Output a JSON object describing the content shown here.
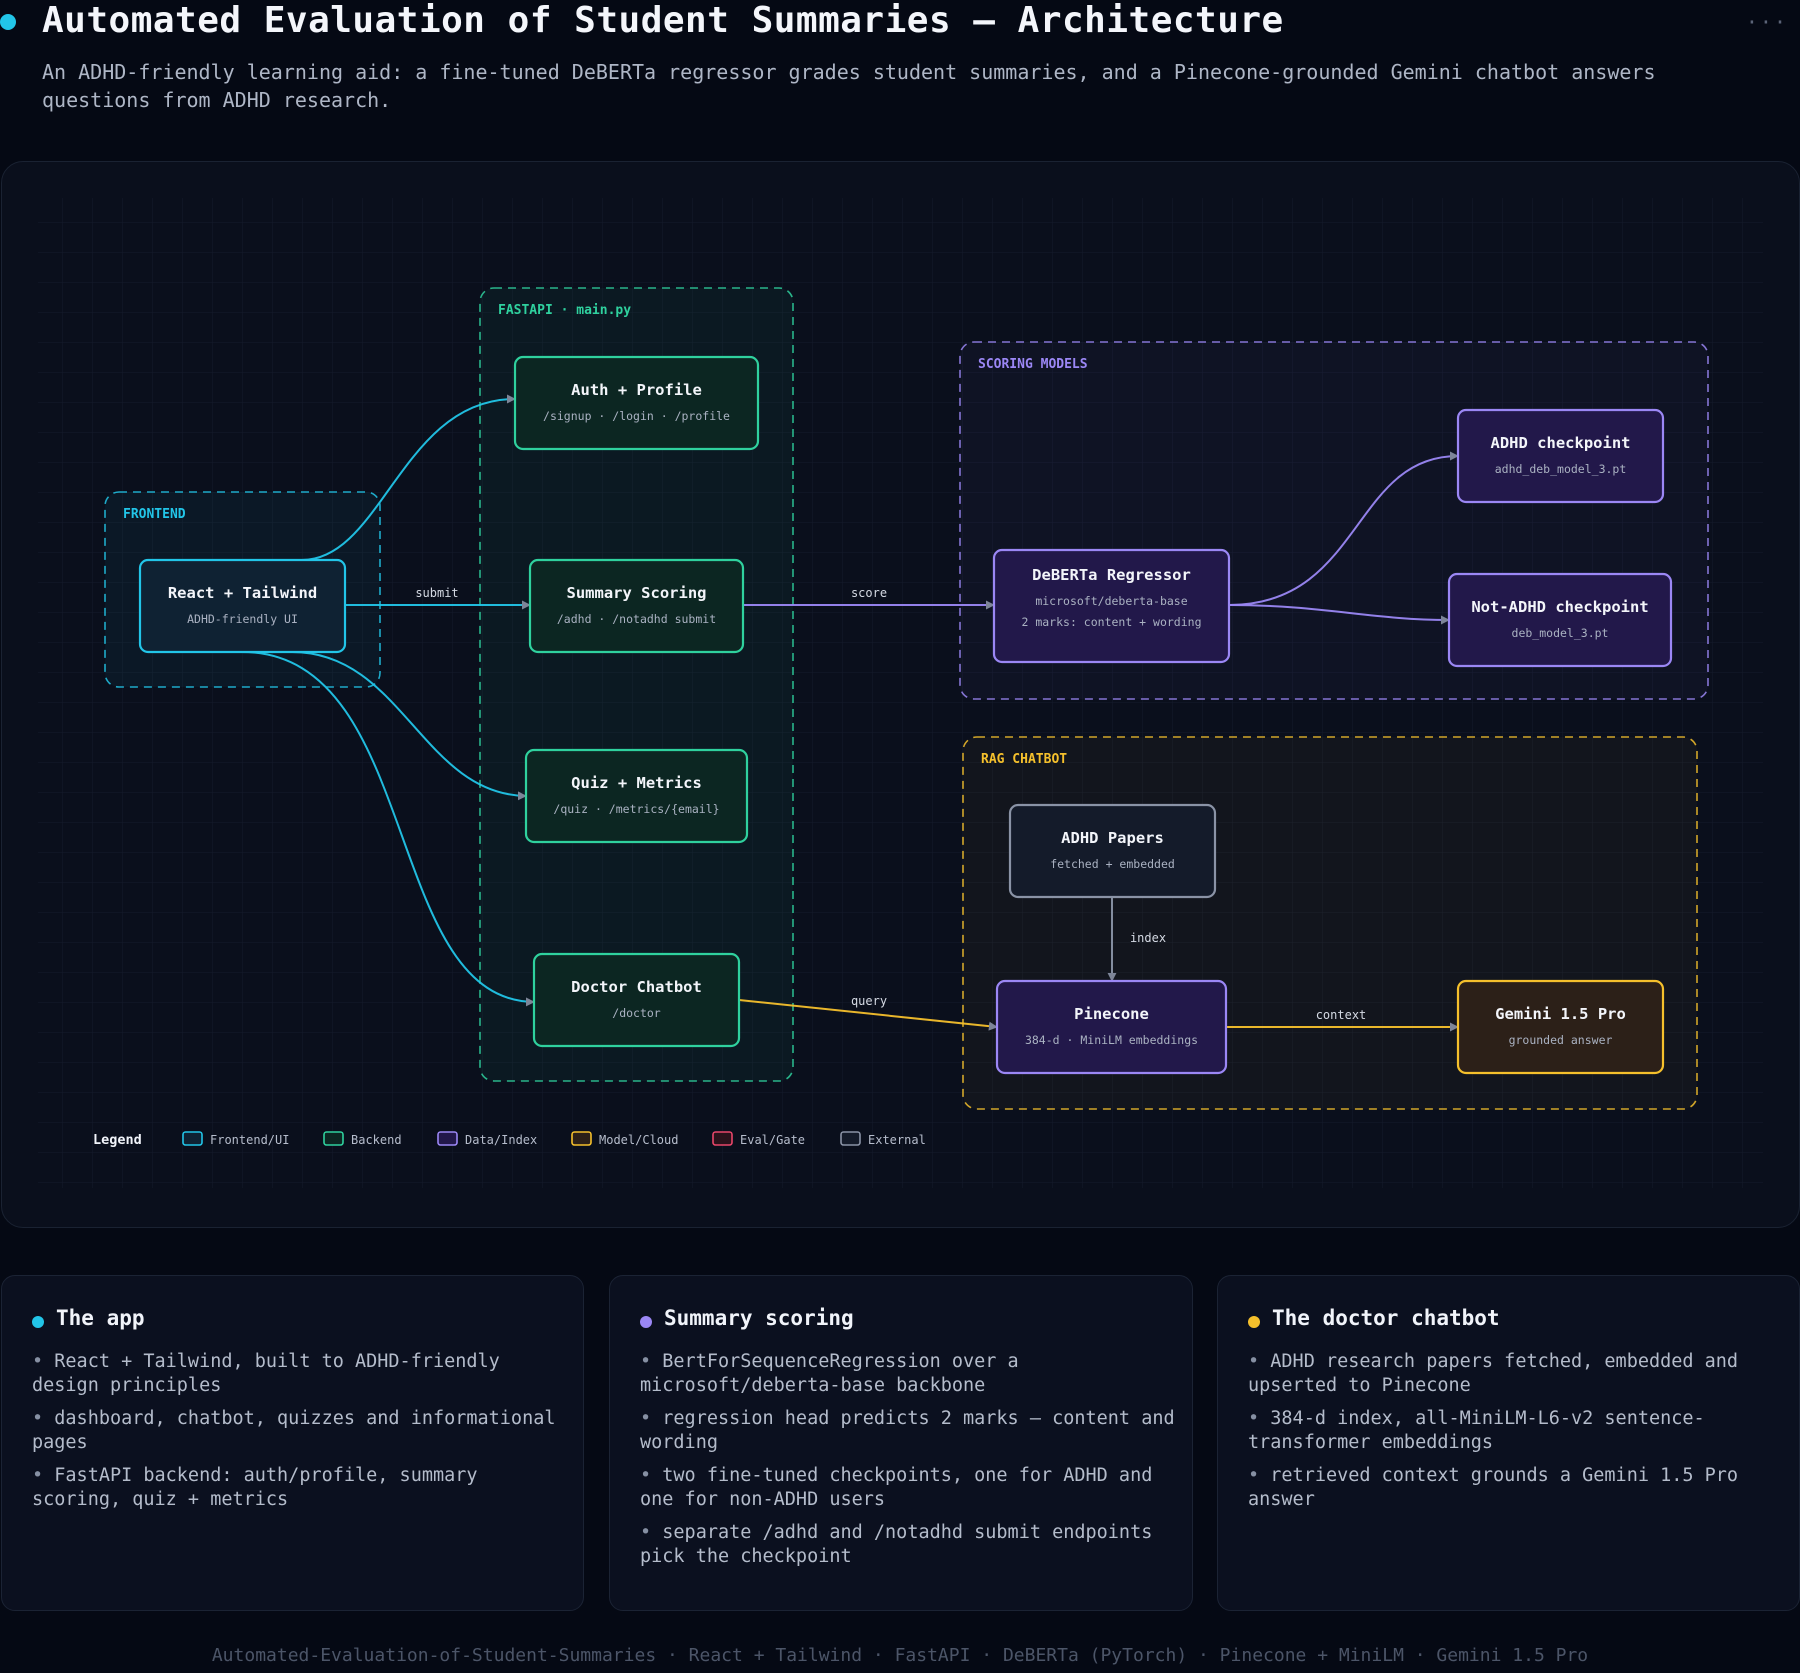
{
  "header": {
    "title": "Automated Evaluation of Student Summaries — Architecture",
    "subtitle": "An ADHD-friendly learning aid: a fine-tuned DeBERTa regressor grades student summaries, and a Pinecone-grounded Gemini chatbot answers questions from ADHD research.",
    "menu": "···"
  },
  "colors": {
    "frontend": "#22c5e8",
    "backend": "#2fd19e",
    "data": "#9b87f5",
    "model": "#f5c02c",
    "eval": "#e8466a",
    "external": "#8a93a6"
  },
  "groups": [
    {
      "id": "frontend",
      "label": "FRONTEND",
      "kind": "frontend"
    },
    {
      "id": "fastapi",
      "label": "FASTAPI · main.py",
      "kind": "backend"
    },
    {
      "id": "scoring",
      "label": "SCORING MODELS",
      "kind": "data"
    },
    {
      "id": "rag",
      "label": "RAG CHATBOT",
      "kind": "model"
    }
  ],
  "nodes": [
    {
      "id": "react",
      "title": "React + Tailwind",
      "sub": "ADHD-friendly UI",
      "kind": "frontend"
    },
    {
      "id": "auth",
      "title": "Auth + Profile",
      "sub": "/signup · /login · /profile",
      "kind": "backend"
    },
    {
      "id": "summary",
      "title": "Summary Scoring",
      "sub": "/adhd · /notadhd submit",
      "kind": "backend"
    },
    {
      "id": "quiz",
      "title": "Quiz + Metrics",
      "sub": "/quiz · /metrics/{email}",
      "kind": "backend"
    },
    {
      "id": "doctor",
      "title": "Doctor Chatbot",
      "sub": "/doctor",
      "kind": "backend"
    },
    {
      "id": "deberta",
      "title": "DeBERTa Regressor",
      "sub": "microsoft/deberta-base",
      "sub2": "2 marks: content + wording",
      "kind": "data"
    },
    {
      "id": "adhdckpt",
      "title": "ADHD checkpoint",
      "sub": "adhd_deb_model_3.pt",
      "kind": "data"
    },
    {
      "id": "notadhd",
      "title": "Not-ADHD checkpoint",
      "sub": "deb_model_3.pt",
      "kind": "data"
    },
    {
      "id": "papers",
      "title": "ADHD Papers",
      "sub": "fetched + embedded",
      "kind": "external"
    },
    {
      "id": "pinecone",
      "title": "Pinecone",
      "sub": "384-d · MiniLM embeddings",
      "kind": "data"
    },
    {
      "id": "gemini",
      "title": "Gemini 1.5 Pro",
      "sub": "grounded answer",
      "kind": "model"
    }
  ],
  "edges": [
    {
      "from": "react",
      "to": "auth",
      "label": "",
      "kind": "frontend"
    },
    {
      "from": "react",
      "to": "summary",
      "label": "submit",
      "kind": "frontend"
    },
    {
      "from": "react",
      "to": "quiz",
      "label": "",
      "kind": "frontend"
    },
    {
      "from": "react",
      "to": "doctor",
      "label": "",
      "kind": "frontend"
    },
    {
      "from": "summary",
      "to": "deberta",
      "label": "score",
      "kind": "data"
    },
    {
      "from": "deberta",
      "to": "adhdckpt",
      "label": "",
      "kind": "data"
    },
    {
      "from": "deberta",
      "to": "notadhd",
      "label": "",
      "kind": "data"
    },
    {
      "from": "papers",
      "to": "pinecone",
      "label": "index",
      "kind": "external"
    },
    {
      "from": "doctor",
      "to": "pinecone",
      "label": "query",
      "kind": "model"
    },
    {
      "from": "pinecone",
      "to": "gemini",
      "label": "context",
      "kind": "model"
    }
  ],
  "legend": {
    "title": "Legend",
    "items": [
      {
        "label": "Frontend/UI",
        "kind": "frontend"
      },
      {
        "label": "Backend",
        "kind": "backend"
      },
      {
        "label": "Data/Index",
        "kind": "data"
      },
      {
        "label": "Model/Cloud",
        "kind": "model"
      },
      {
        "label": "Eval/Gate",
        "kind": "eval"
      },
      {
        "label": "External",
        "kind": "external"
      }
    ]
  },
  "cards": [
    {
      "title": "The app",
      "kind": "frontend",
      "items": [
        "React + Tailwind, built to ADHD-friendly design principles",
        "dashboard, chatbot, quizzes and informational pages",
        "FastAPI backend: auth/profile, summary scoring, quiz + metrics"
      ]
    },
    {
      "title": "Summary scoring",
      "kind": "data",
      "items": [
        "BertForSequenceRegression over a microsoft/deberta-base backbone",
        "regression head predicts 2 marks — content and wording",
        "two fine-tuned checkpoints, one for ADHD and one for non-ADHD users",
        "separate /adhd and /notadhd submit endpoints pick the checkpoint"
      ]
    },
    {
      "title": "The doctor chatbot",
      "kind": "model",
      "items": [
        "ADHD research papers fetched, embedded and upserted to Pinecone",
        "384-d index, all-MiniLM-L6-v2 sentence-transformer embeddings",
        "retrieved context grounds a Gemini 1.5 Pro answer"
      ]
    }
  ],
  "footer": "Automated-Evaluation-of-Student-Summaries · React + Tailwind · FastAPI · DeBERTa (PyTorch) · Pinecone + MiniLM · Gemini 1.5 Pro"
}
